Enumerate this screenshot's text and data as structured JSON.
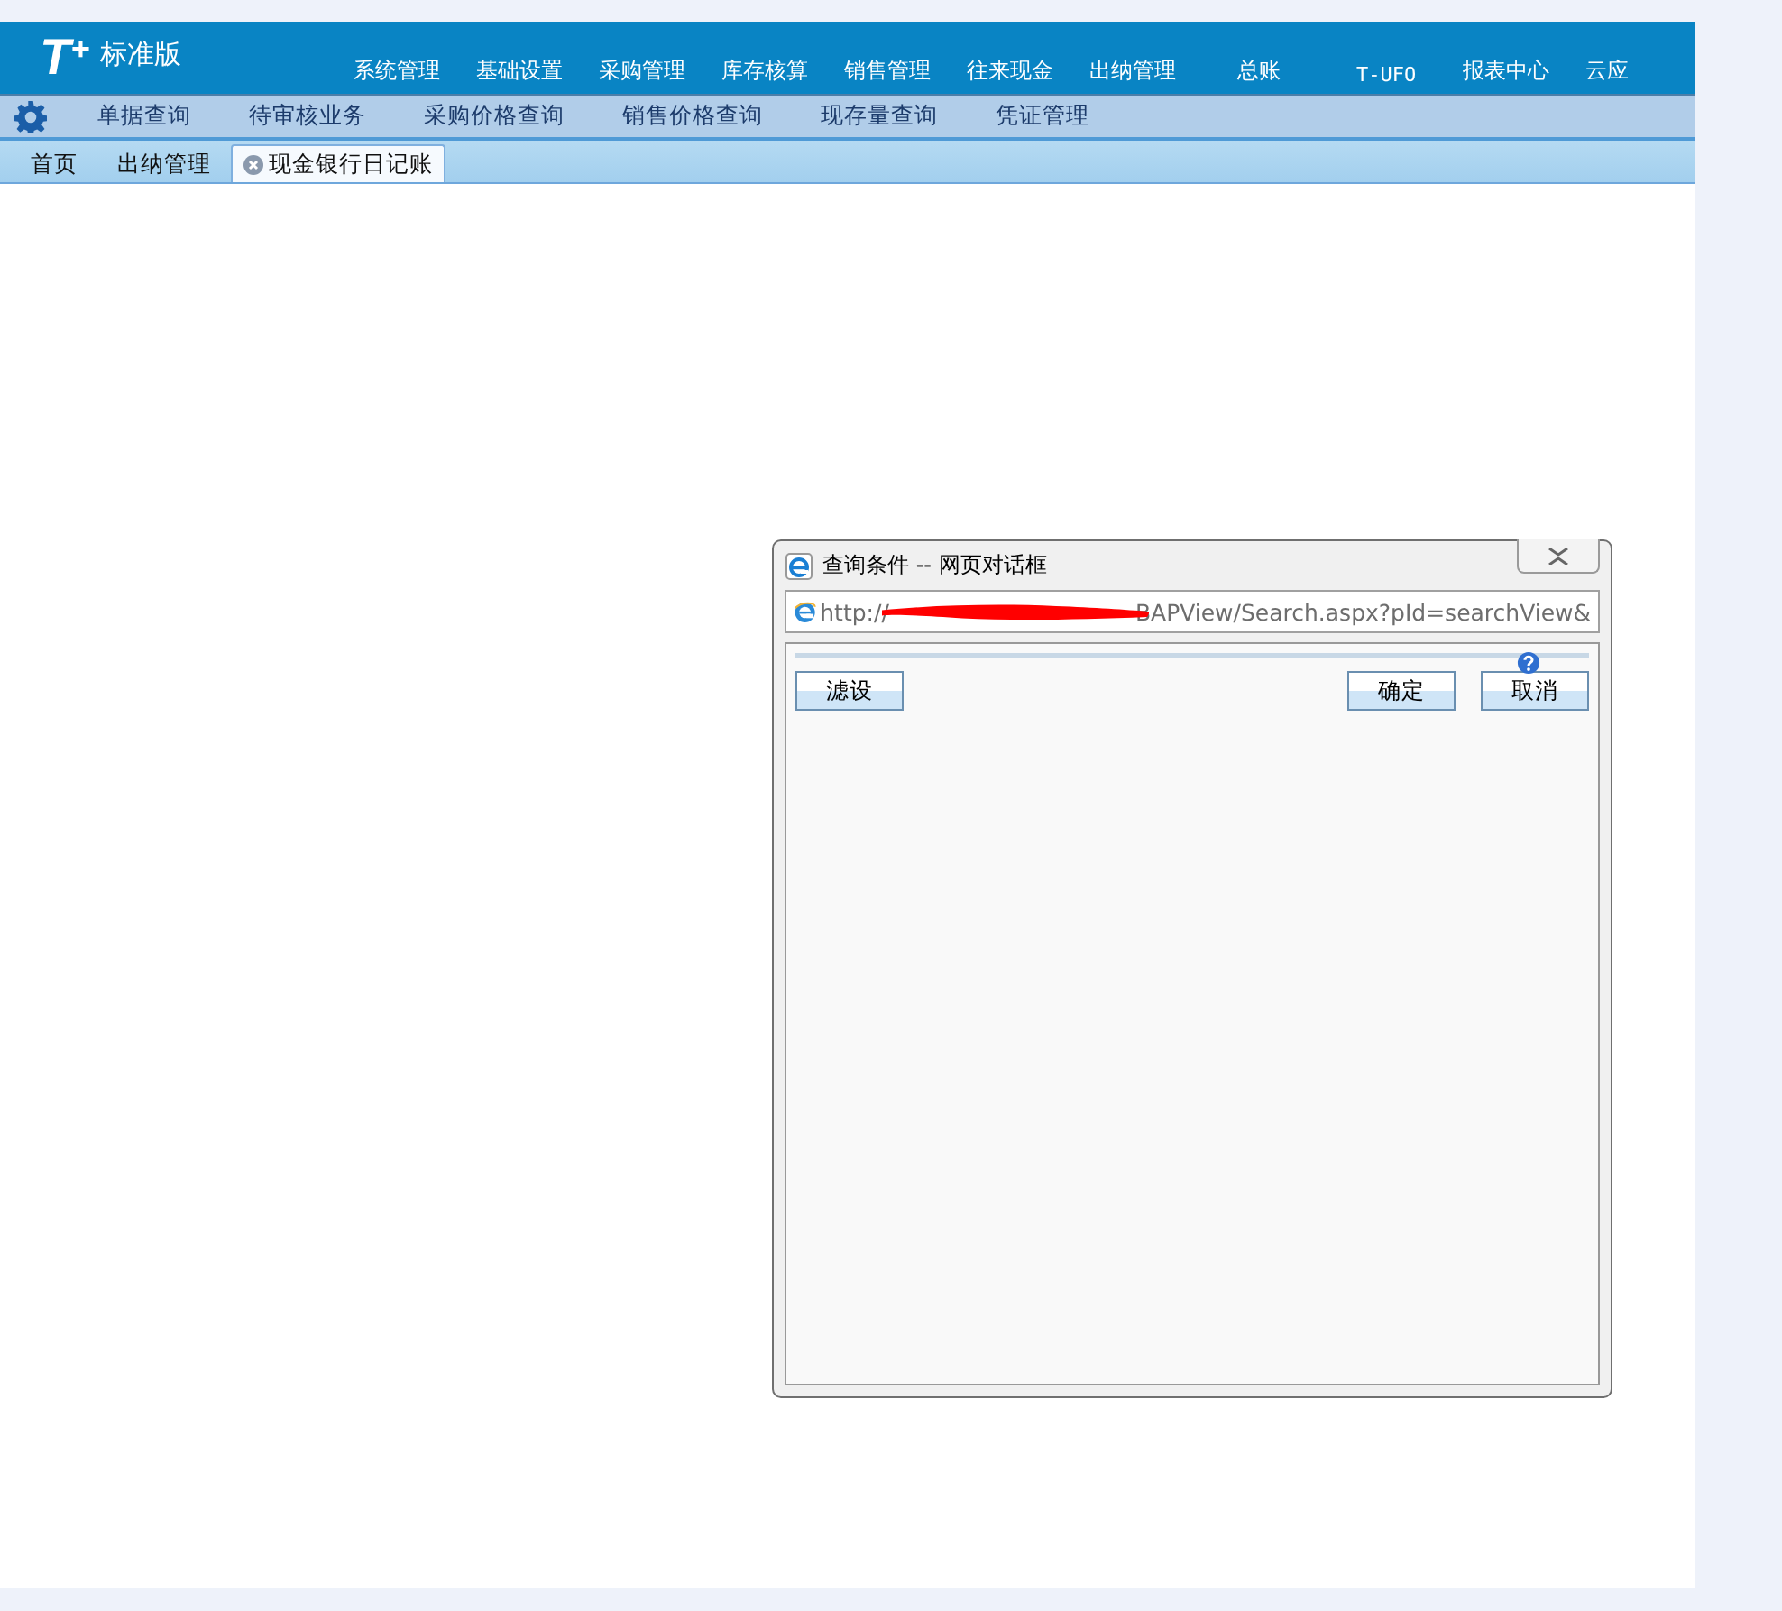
{
  "logo": {
    "mark": "T$^{+}$",
    "edition": "标准版"
  },
  "main_menu": [
    "系统管理",
    "基础设置",
    "采购管理",
    "库存核算",
    "销售管理",
    "往来现金",
    "出纳管理",
    "总账",
    "T-UFO",
    "报表中心",
    "云应"
  ],
  "quick_links": [
    "单据查询",
    "待审核业务",
    "采购价格查询",
    "销售价格查询",
    "现存量查询",
    "凭证管理"
  ],
  "tabs": [
    {
      "label": "首页",
      "selected": false,
      "closable": false
    },
    {
      "label": "出纳管理",
      "selected": false,
      "closable": false
    },
    {
      "label": "现金银行日记账",
      "selected": true,
      "closable": true
    }
  ],
  "dialog": {
    "title": "查询条件 -- 网页对话框",
    "url_start": "http://",
    "url_end": "BAPView/Search.aspx?pId=searchView&",
    "buttons_left": [
      "滤设"
    ],
    "buttons_right": [
      "确定",
      "取消"
    ]
  }
}
